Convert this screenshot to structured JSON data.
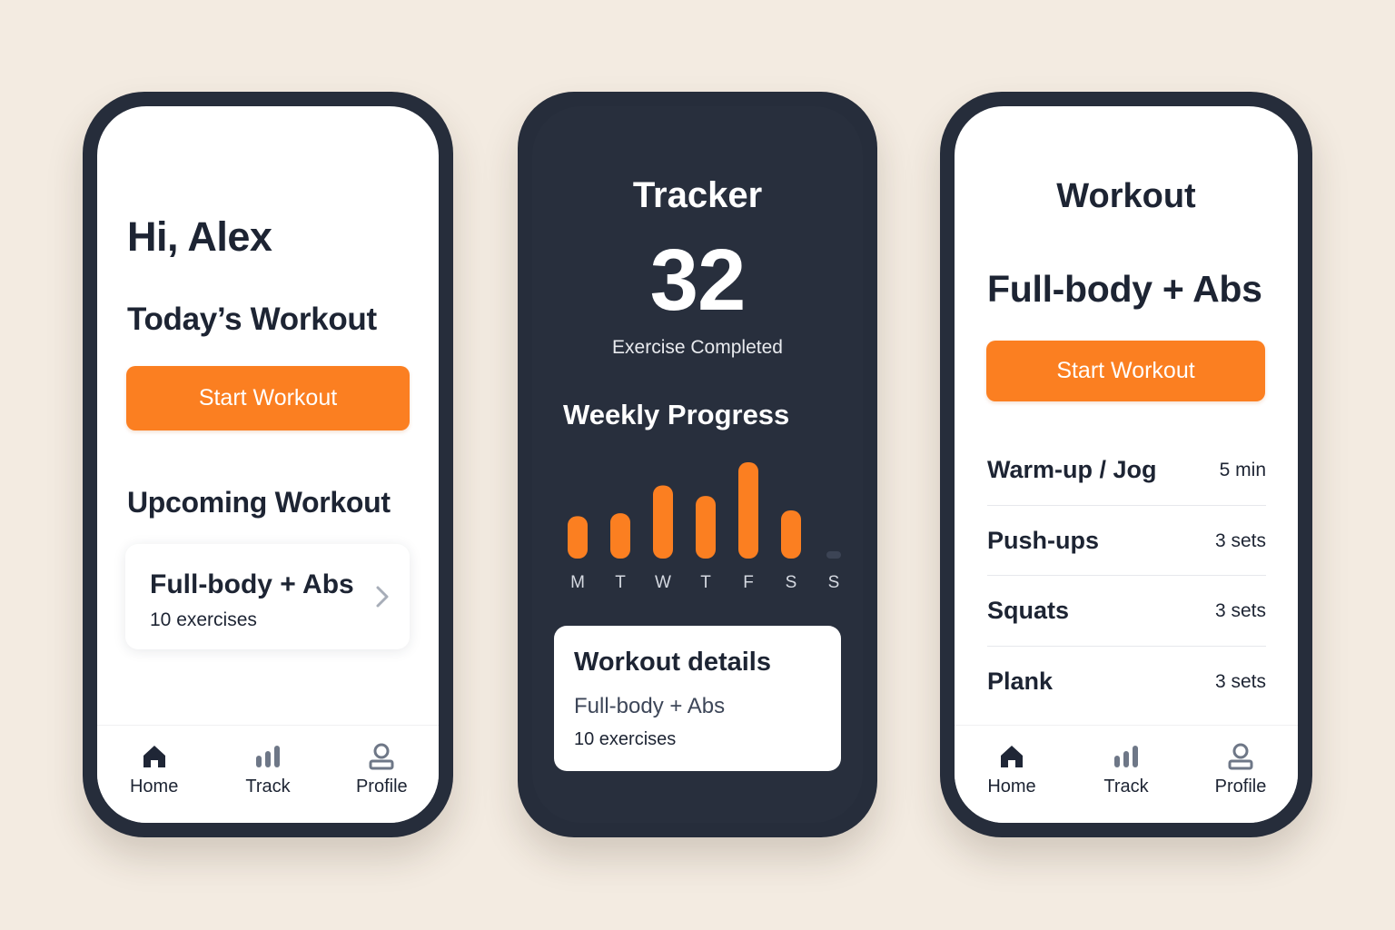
{
  "colors": {
    "accent": "#fb7f21",
    "navy": "#262d3b",
    "background": "#f3ebe1"
  },
  "home": {
    "greeting": "Hi, Alex",
    "todays_title": "Today’s Workout",
    "start_button": "Start Workout",
    "upcoming_title": "Upcoming Workout",
    "upcoming_card": {
      "title": "Full-body + Abs",
      "subtitle": "10 exercises",
      "icon": "chevron-right-icon"
    }
  },
  "nav": {
    "items": [
      {
        "label": "Home",
        "icon": "home-icon"
      },
      {
        "label": "Track",
        "icon": "bar-chart-icon"
      },
      {
        "label": "Profile",
        "icon": "user-icon"
      }
    ]
  },
  "tracker": {
    "title": "Tracker",
    "count": "32",
    "count_label": "Exercise Completed",
    "weekly_title": "Weekly Progress",
    "details": {
      "title": "Workout details",
      "workout": "Full-body + Abs",
      "count": "10 exercises"
    }
  },
  "chart_data": {
    "type": "bar",
    "categories": [
      "M",
      "T",
      "W",
      "T",
      "F",
      "S",
      "S"
    ],
    "values": [
      0.44,
      0.47,
      0.76,
      0.65,
      1.0,
      0.5,
      0.02
    ],
    "ylim": [
      0,
      1
    ],
    "grid": false
  },
  "workout": {
    "title": "Workout",
    "name": "Full-body + Abs",
    "start_button": "Start Workout",
    "exercises": [
      {
        "name": "Warm-up / Jog",
        "value": "5 min"
      },
      {
        "name": "Push-ups",
        "value": "3 sets"
      },
      {
        "name": "Squats",
        "value": "3 sets"
      },
      {
        "name": "Plank",
        "value": "3 sets"
      }
    ]
  }
}
